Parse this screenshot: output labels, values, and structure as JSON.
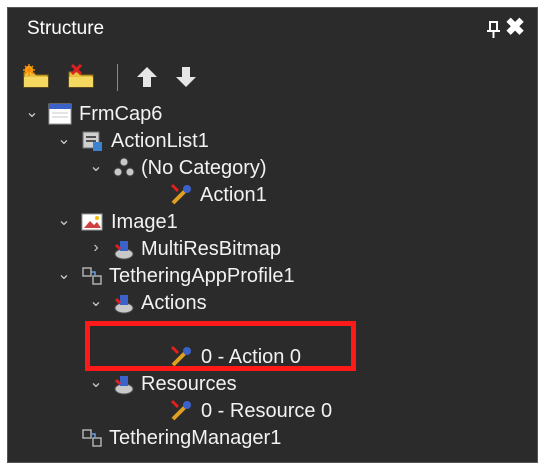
{
  "panel": {
    "title": "Structure",
    "pin_icon": "pin-icon",
    "close_icon": "close-icon"
  },
  "toolbar": {
    "buttons": [
      {
        "name": "new-item-button",
        "icon": "folder-new-icon"
      },
      {
        "name": "delete-item-button",
        "icon": "folder-delete-icon"
      },
      {
        "name": "move-up-button",
        "icon": "arrow-up-icon"
      },
      {
        "name": "move-down-button",
        "icon": "arrow-down-icon"
      }
    ]
  },
  "tree": {
    "nodes": [
      {
        "label": "FrmCap6",
        "icon": "form-icon",
        "expanded": true
      },
      {
        "label": "ActionList1",
        "icon": "action-list-icon",
        "expanded": true
      },
      {
        "label": "(No Category)",
        "icon": "category-icon",
        "expanded": true
      },
      {
        "label": "Action1",
        "icon": "action-icon"
      },
      {
        "label": "Image1",
        "icon": "image-icon",
        "expanded": true
      },
      {
        "label": "MultiResBitmap",
        "icon": "collection-icon",
        "expanded": false
      },
      {
        "label": "TetheringAppProfile1",
        "icon": "component-icon",
        "expanded": true
      },
      {
        "label": "Actions",
        "icon": "collection-icon",
        "expanded": true
      },
      {
        "label": "0 - Action 0",
        "icon": "action-icon"
      },
      {
        "label": "Resources",
        "icon": "collection-icon",
        "expanded": true
      },
      {
        "label": "0 - Resource 0",
        "icon": "action-icon"
      },
      {
        "label": "TetheringManager1",
        "icon": "component-icon"
      }
    ]
  },
  "annotation": {
    "color": "#ff1a1a"
  },
  "colors": {
    "background": "#2b2b2b",
    "text": "#f2f2f2"
  }
}
